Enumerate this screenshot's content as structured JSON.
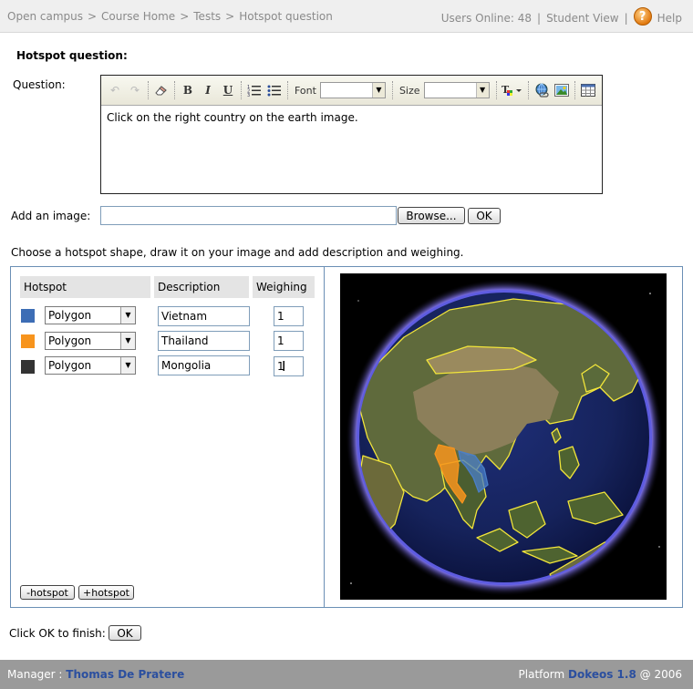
{
  "breadcrumb": [
    "Open campus",
    "Course Home",
    "Tests",
    "Hotspot question"
  ],
  "breadcrumb_sep": ">",
  "header": {
    "users_online": "Users Online: 48",
    "divider": "|",
    "student_view": "Student View",
    "help": "Help",
    "help_icon_glyph": "?"
  },
  "page_title": "Hotspot question:",
  "question": {
    "label": "Question:",
    "text": "Click on the right country on the earth image.",
    "toolbar": {
      "font_label": "Font",
      "size_label": "Size",
      "font_value": "",
      "size_value": ""
    }
  },
  "image": {
    "label": "Add an image:",
    "value": "",
    "browse_label": "Browse...",
    "ok_label": "OK"
  },
  "instructions": "Choose a hotspot shape, draw it on your image and add description and weighing.",
  "table": {
    "headers": [
      "Hotspot",
      "Description",
      "Weighing"
    ],
    "rows": [
      {
        "color": "#3d6db5",
        "shape": "Polygon",
        "description": "Vietnam",
        "weighing": "1"
      },
      {
        "color": "#f7941d",
        "shape": "Polygon",
        "description": "Thailand",
        "weighing": "1"
      },
      {
        "color": "#333333",
        "shape": "Polygon",
        "description": "Mongolia",
        "weighing": "1"
      }
    ]
  },
  "hotspot_buttons": {
    "remove": "-hotspot",
    "add": "+hotspot"
  },
  "finish": {
    "label": "Click OK to finish:",
    "ok_label": "OK"
  },
  "footer": {
    "manager_label": "Manager :",
    "manager_name": "Thomas De Pratere",
    "platform_label": "Platform",
    "platform_name": "Dokeos 1.8",
    "year": "@ 2006"
  },
  "colors": {
    "accent": "#2b4f9f",
    "panel_border": "#6a8fb5",
    "footer_bg": "#9a9a9a"
  }
}
